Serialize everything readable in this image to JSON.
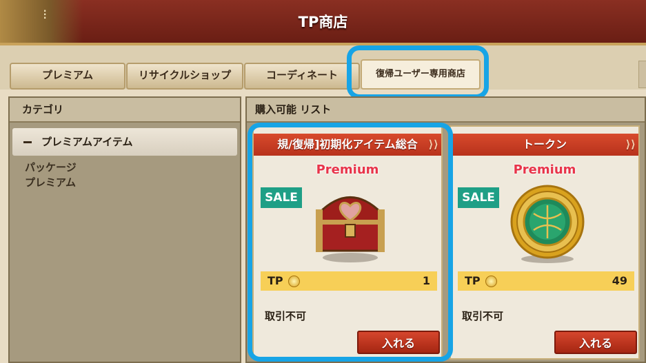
{
  "header": {
    "title": "TP商店"
  },
  "tabs": [
    {
      "label": "プレミアム"
    },
    {
      "label": "リサイクルショップ"
    },
    {
      "label": "コーディネート"
    },
    {
      "label": "復帰ユーザー専用商店",
      "active": true
    }
  ],
  "category": {
    "header": "カテゴリ",
    "selected": "プレミアムアイテム",
    "subitems": [
      "パッケージ",
      "プレミアム"
    ]
  },
  "list": {
    "header": "購入可能 リスト",
    "items": [
      {
        "name": "規/復帰]初期化アイテム総合",
        "badge": "Premium",
        "sale": "SALE",
        "currency": "TP",
        "price": "1",
        "trade": "取引不可",
        "button": "入れる",
        "icon": "treasure-chest-icon"
      },
      {
        "name": "トークン",
        "badge": "Premium",
        "sale": "SALE",
        "currency": "TP",
        "price": "49",
        "trade": "取引不可",
        "button": "入れる",
        "icon": "token-coin-icon"
      }
    ]
  },
  "colors": {
    "highlight": "#17a4e6",
    "banner": "#c83a22",
    "sale": "#1e9f86",
    "price_bar": "#f7cf57"
  }
}
